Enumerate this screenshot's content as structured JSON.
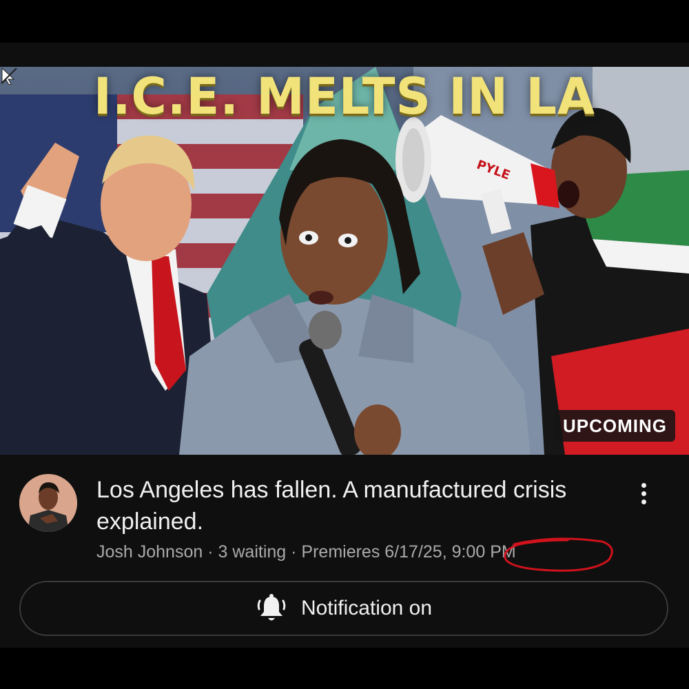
{
  "thumbnail": {
    "headline": "I.C.E. MELTS IN LA",
    "badge": "UPCOMING",
    "megaphone_brand": "PYLE",
    "cursor_icon": "pointer-arrow-icon"
  },
  "video": {
    "title": "Los Angeles has fallen. A manufactured crisis explained.",
    "channel": "Josh Johnson",
    "waiting": "3 waiting",
    "premiere": "Premieres 6/17/25, 9:00 PM"
  },
  "menu": {
    "icon": "more-vertical-icon"
  },
  "notification_button": {
    "label": "Notification on",
    "icon": "bell-ringing-icon"
  },
  "colors": {
    "background": "#0f0f0f",
    "headline": "#f2e27a",
    "annotation": "#d0121c",
    "secondary_text": "#aaaaaa"
  }
}
